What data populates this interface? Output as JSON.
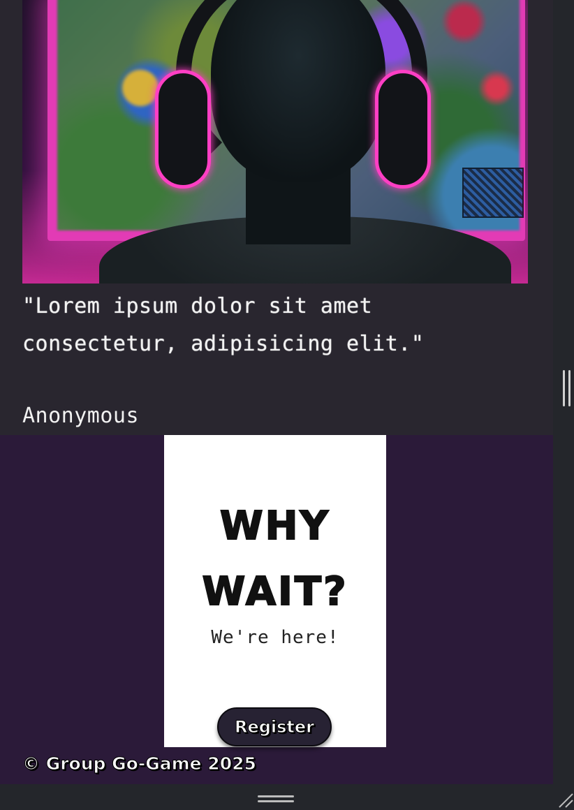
{
  "hero": {
    "image_alt": "Gamer wearing headphones in front of a glowing monitor"
  },
  "testimonial": {
    "quote": "\"Lorem ipsum dolor sit amet consectetur, adipisicing elit.\"",
    "author": "Anonymous"
  },
  "cta": {
    "title_line1": "WHY",
    "title_line2": "WAIT?",
    "subtitle": "We're here!",
    "button_label": "Register"
  },
  "footer": {
    "copyright": "© Group Go-Game 2025"
  },
  "colors": {
    "page_bg": "#29262f",
    "cta_section_bg": "#2b1a39",
    "card_bg": "#ffffff",
    "button_bg": "#272233",
    "neon_accent": "#ff3fc4"
  }
}
